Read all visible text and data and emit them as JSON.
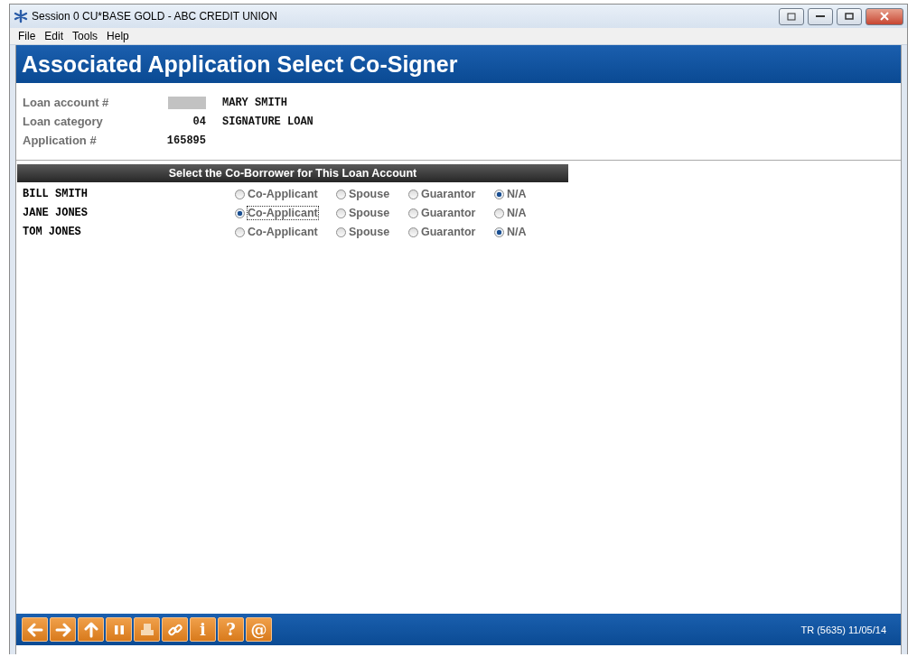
{
  "window": {
    "title": "Session 0 CU*BASE GOLD - ABC CREDIT UNION"
  },
  "menu": [
    "File",
    "Edit",
    "Tools",
    "Help"
  ],
  "header": {
    "title": "Associated Application Select Co-Signer"
  },
  "fields": [
    {
      "label": "Loan account #",
      "text": "MARY SMITH"
    },
    {
      "label": "Loan category",
      "value": "04",
      "text": "SIGNATURE LOAN"
    },
    {
      "label": "Application #",
      "value": "165895"
    }
  ],
  "section": {
    "title": "Select the Co-Borrower for This Loan Account"
  },
  "rows": [
    {
      "name": "BILL SMITH",
      "options": [
        {
          "label": "Co-Applicant",
          "selected": false,
          "focused": false
        },
        {
          "label": "Spouse",
          "selected": false,
          "focused": false
        },
        {
          "label": "Guarantor",
          "selected": false,
          "focused": false
        },
        {
          "label": "N/A",
          "selected": true,
          "focused": false
        }
      ]
    },
    {
      "name": "JANE JONES",
      "options": [
        {
          "label": "Co-Applicant",
          "selected": true,
          "focused": true
        },
        {
          "label": "Spouse",
          "selected": false,
          "focused": false
        },
        {
          "label": "Guarantor",
          "selected": false,
          "focused": false
        },
        {
          "label": "N/A",
          "selected": false,
          "focused": false
        }
      ]
    },
    {
      "name": "TOM JONES",
      "options": [
        {
          "label": "Co-Applicant",
          "selected": false,
          "focused": false
        },
        {
          "label": "Spouse",
          "selected": false,
          "focused": false
        },
        {
          "label": "Guarantor",
          "selected": false,
          "focused": false
        },
        {
          "label": "N/A",
          "selected": true,
          "focused": false
        }
      ]
    }
  ],
  "toolbar": [
    {
      "kind": "back"
    },
    {
      "kind": "forward"
    },
    {
      "kind": "up"
    },
    {
      "kind": "pause"
    },
    {
      "kind": "print"
    },
    {
      "kind": "link"
    },
    {
      "kind": "text",
      "text": "i"
    },
    {
      "kind": "text",
      "text": "?"
    },
    {
      "kind": "text",
      "text": "@"
    }
  ],
  "status": "TR (5635) 11/05/14"
}
